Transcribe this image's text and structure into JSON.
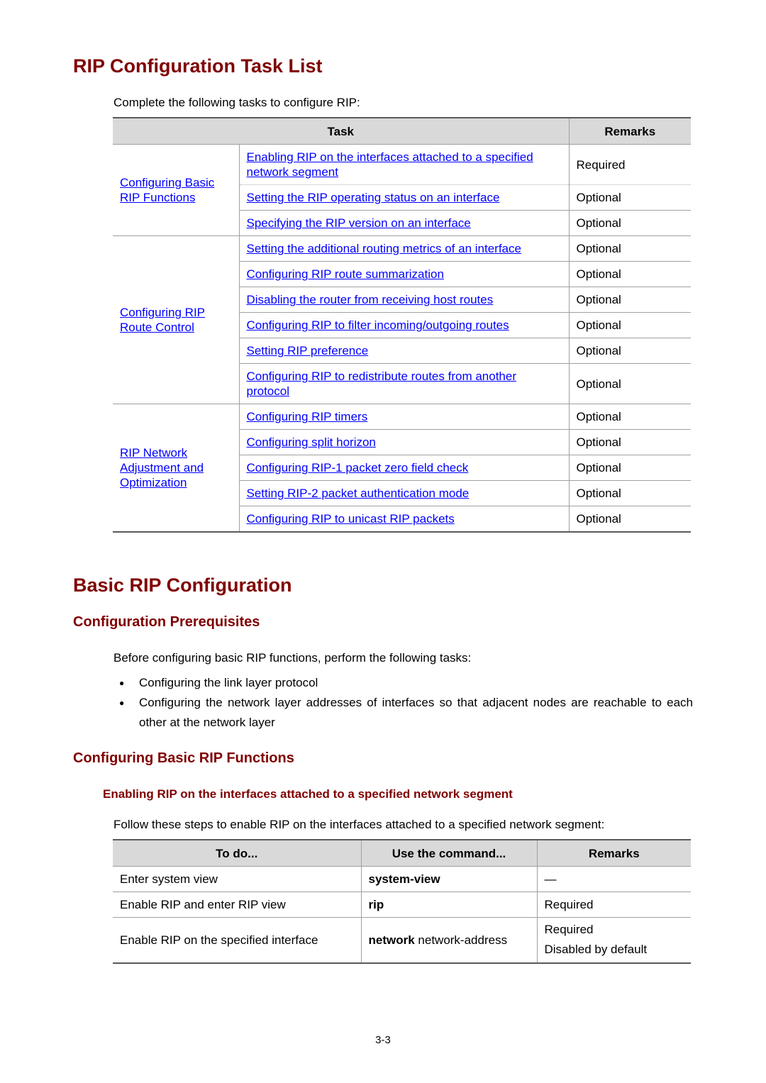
{
  "section1": {
    "title": "RIP Configuration Task List",
    "intro": "Complete the following tasks to configure RIP:",
    "table": {
      "headers": {
        "task": "Task",
        "remarks": "Remarks"
      },
      "groups": [
        {
          "label": "Configuring Basic RIP Functions",
          "rows": [
            {
              "task": "Enabling RIP on the interfaces attached to a specified network segment",
              "remark": "Required"
            },
            {
              "task": "Setting the RIP operating status on an interface",
              "remark": "Optional"
            },
            {
              "task": "Specifying the RIP version on an interface",
              "remark": "Optional"
            }
          ]
        },
        {
          "label": "Configuring RIP Route Control",
          "rows": [
            {
              "task": "Setting the additional routing metrics of an interface",
              "remark": "Optional"
            },
            {
              "task": "Configuring RIP route summarization",
              "remark": "Optional"
            },
            {
              "task": "Disabling the router from receiving host routes",
              "remark": "Optional"
            },
            {
              "task": "Configuring RIP to filter incoming/outgoing routes",
              "remark": "Optional"
            },
            {
              "task": "Setting RIP preference",
              "remark": "Optional"
            },
            {
              "task": "Configuring RIP to redistribute routes from another protocol",
              "remark": "Optional"
            }
          ]
        },
        {
          "label": "RIP Network Adjustment and Optimization",
          "rows": [
            {
              "task": "Configuring RIP timers",
              "remark": "Optional"
            },
            {
              "task": "Configuring split horizon",
              "remark": "Optional"
            },
            {
              "task": "Configuring RIP-1 packet zero field check",
              "remark": "Optional"
            },
            {
              "task": "Setting RIP-2 packet authentication mode",
              "remark": "Optional"
            },
            {
              "task": "Configuring RIP to unicast RIP packets",
              "remark": "Optional"
            }
          ]
        }
      ]
    }
  },
  "section2": {
    "title": "Basic RIP Configuration",
    "prereq": {
      "title": "Configuration Prerequisites",
      "intro": "Before configuring basic RIP functions, perform the following tasks:",
      "bullets": [
        "Configuring the link layer protocol",
        "Configuring the network layer addresses of interfaces so that adjacent nodes are reachable to each other at the network layer"
      ]
    },
    "basic": {
      "title": "Configuring Basic RIP Functions",
      "subtitle": "Enabling RIP on the interfaces attached to a specified network segment",
      "intro": "Follow these steps to enable RIP on the interfaces attached to a specified network segment:",
      "table": {
        "headers": {
          "todo": "To do...",
          "command": "Use the command...",
          "remarks": "Remarks"
        },
        "rows": [
          {
            "todo": "Enter system view",
            "cmd_bold": "system-view",
            "cmd_arg": "",
            "remark1": "—",
            "remark2": ""
          },
          {
            "todo": "Enable RIP and enter RIP view",
            "cmd_bold": "rip",
            "cmd_arg": "",
            "remark1": "Required",
            "remark2": ""
          },
          {
            "todo": "Enable RIP on the specified interface",
            "cmd_bold": "network",
            "cmd_arg": " network-address",
            "remark1": "Required",
            "remark2": "Disabled by default"
          }
        ]
      }
    }
  },
  "footer": {
    "page_number": "3-3"
  },
  "colors": {
    "heading": "#800000",
    "link": "#0000ff",
    "header_bg": "#d9d9d9"
  }
}
